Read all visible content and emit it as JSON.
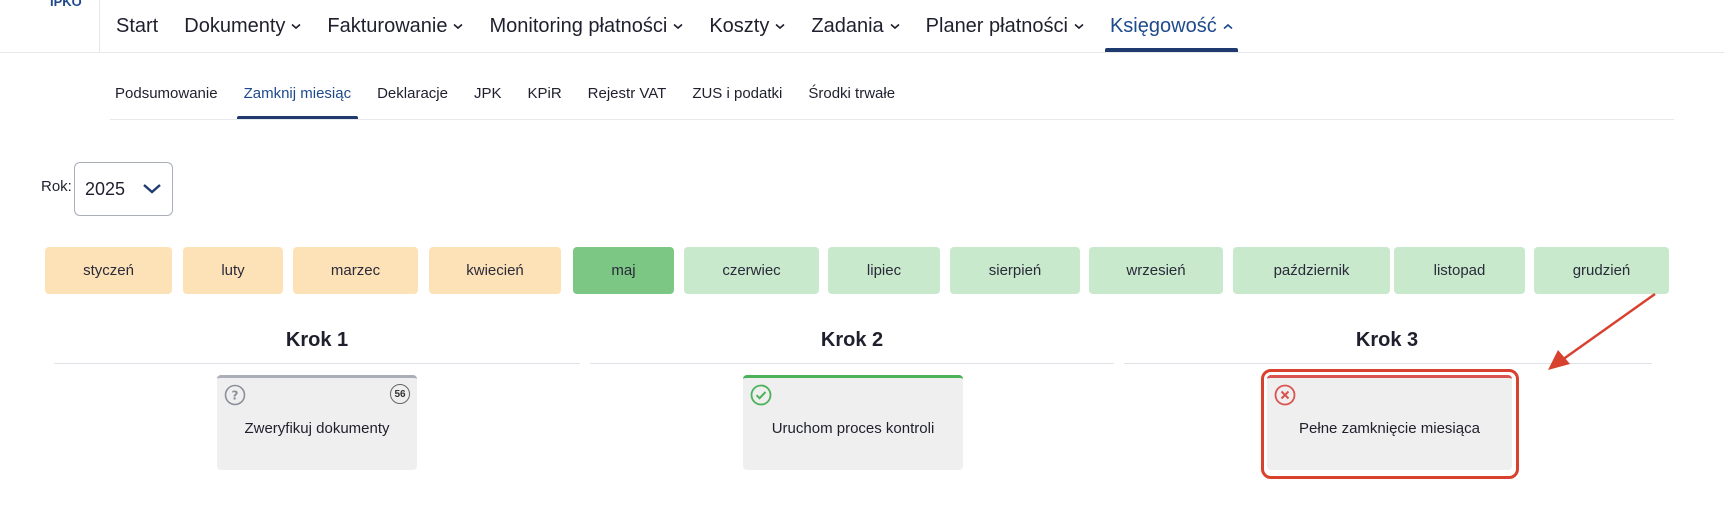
{
  "logo": "IPKO",
  "topnav": [
    {
      "label": "Start",
      "chevron": false,
      "active": false
    },
    {
      "label": "Dokumenty",
      "chevron": "down",
      "active": false
    },
    {
      "label": "Fakturowanie",
      "chevron": "down",
      "active": false
    },
    {
      "label": "Monitoring płatności",
      "chevron": "down",
      "active": false
    },
    {
      "label": "Koszty",
      "chevron": "down",
      "active": false
    },
    {
      "label": "Zadania",
      "chevron": "down",
      "active": false
    },
    {
      "label": "Planer płatności",
      "chevron": "down",
      "active": false
    },
    {
      "label": "Księgowość",
      "chevron": "up",
      "active": true
    }
  ],
  "subnav": [
    {
      "label": "Podsumowanie",
      "active": false
    },
    {
      "label": "Zamknij miesiąc",
      "active": true
    },
    {
      "label": "Deklaracje",
      "active": false
    },
    {
      "label": "JPK",
      "active": false
    },
    {
      "label": "KPiR",
      "active": false
    },
    {
      "label": "Rejestr VAT",
      "active": false
    },
    {
      "label": "ZUS i podatki",
      "active": false
    },
    {
      "label": "Środki trwałe",
      "active": false
    }
  ],
  "year": {
    "label": "Rok:",
    "value": "2025"
  },
  "months": [
    {
      "label": "styczeń",
      "status": "past"
    },
    {
      "label": "luty",
      "status": "past"
    },
    {
      "label": "marzec",
      "status": "past"
    },
    {
      "label": "kwiecień",
      "status": "past"
    },
    {
      "label": "maj",
      "status": "current"
    },
    {
      "label": "czerwiec",
      "status": "future"
    },
    {
      "label": "lipiec",
      "status": "future"
    },
    {
      "label": "sierpień",
      "status": "future"
    },
    {
      "label": "wrzesień",
      "status": "future"
    },
    {
      "label": "październik",
      "status": "future"
    },
    {
      "label": "listopad",
      "status": "future"
    },
    {
      "label": "grudzień",
      "status": "future"
    }
  ],
  "steps": [
    {
      "title": "Krok 1",
      "card_label": "Zweryfikuj dokumenty",
      "status_icon": "question-icon",
      "count": "56"
    },
    {
      "title": "Krok 2",
      "card_label": "Uruchom proces kontroli",
      "status_icon": "check-circle-icon"
    },
    {
      "title": "Krok 3",
      "card_label": "Pełne zamknięcie miesiąca",
      "status_icon": "error-circle-icon"
    }
  ],
  "colors": {
    "accent": "#1e4a8c",
    "month_past": "#fde2b8",
    "month_current": "#7cc784",
    "month_future": "#c8e9cc",
    "highlight": "#d9412f"
  }
}
